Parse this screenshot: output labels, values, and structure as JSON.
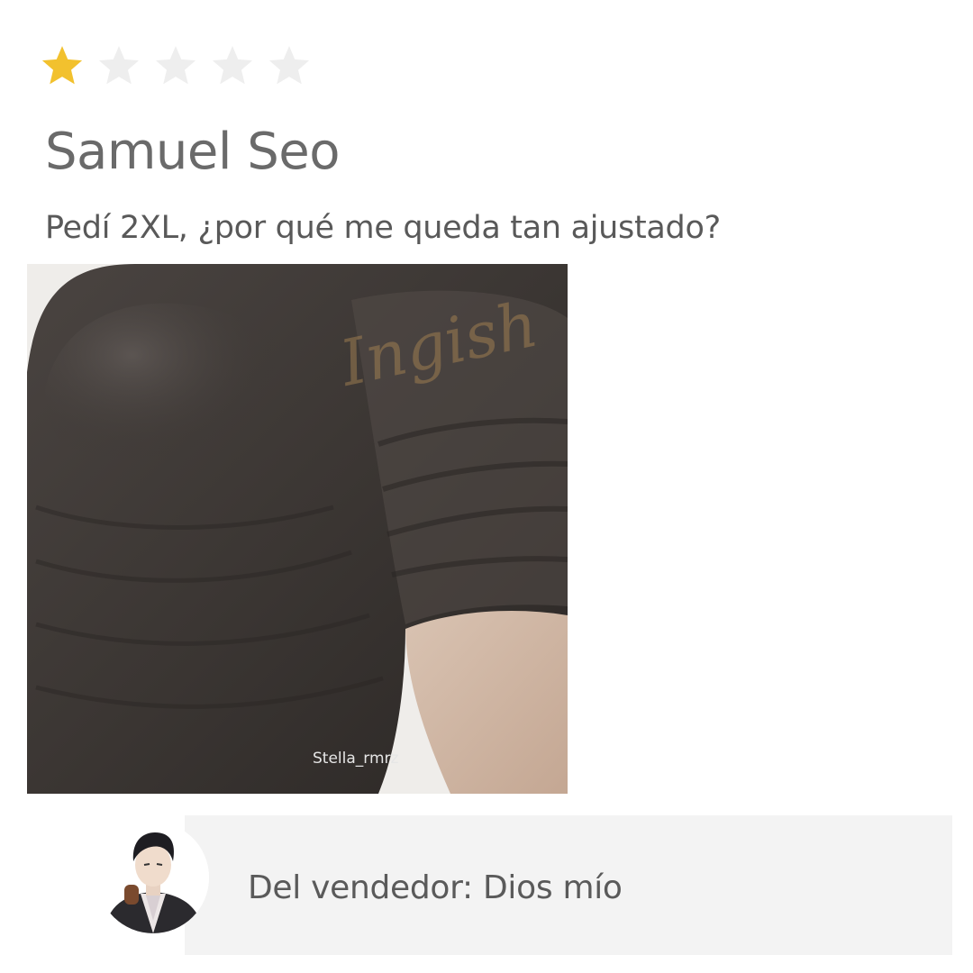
{
  "review": {
    "rating": 1,
    "max_rating": 5,
    "reviewer_name": "Samuel Seo",
    "text": "Pedí 2XL, ¿por qué me queda tan ajustado?",
    "photo": {
      "watermark": "Ingish",
      "credit": "Stella_rmrz"
    }
  },
  "seller_reply": {
    "text": "Del vendedor: Dios mío",
    "avatar": "manga-man-avatar"
  },
  "colors": {
    "star_filled": "#f2c12e",
    "star_empty": "#eeeeee",
    "name": "#6a6a6a",
    "body_text": "#595959",
    "reply_bg": "#f3f3f3"
  }
}
